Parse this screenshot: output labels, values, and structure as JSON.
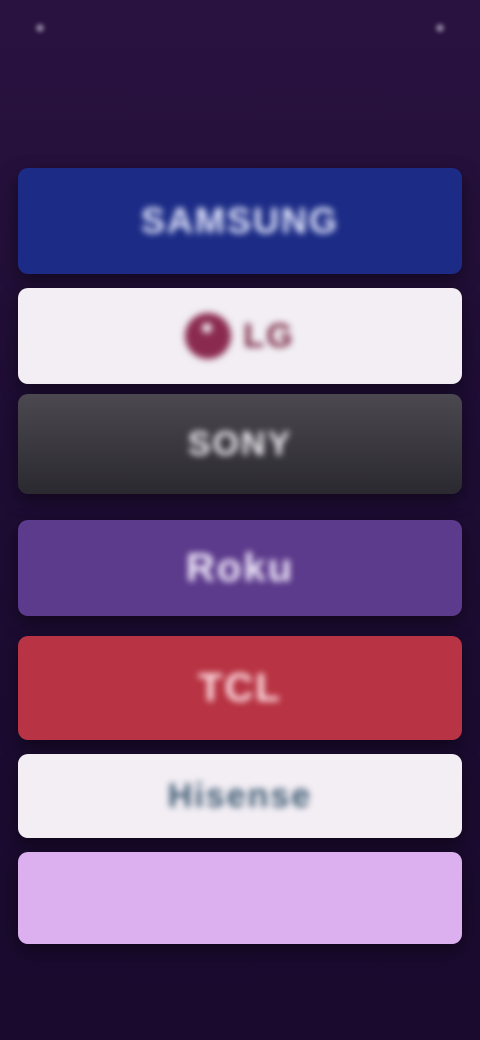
{
  "screen": {
    "background": "#1e0d34"
  },
  "brands": [
    {
      "label": "SAMSUNG",
      "bg": "#1c2c86"
    },
    {
      "label": "LG",
      "bg": "#f2eef4",
      "logo_color": "#8a2a4e"
    },
    {
      "label": "SONY",
      "bg": "#3a3840"
    },
    {
      "label": "Roku",
      "bg": "#5c3a8c"
    },
    {
      "label": "TCL",
      "bg": "#b83343"
    },
    {
      "label": "Hisense",
      "bg": "#f3eef4"
    },
    {
      "label": "",
      "bg": "#dcb0ee"
    }
  ]
}
